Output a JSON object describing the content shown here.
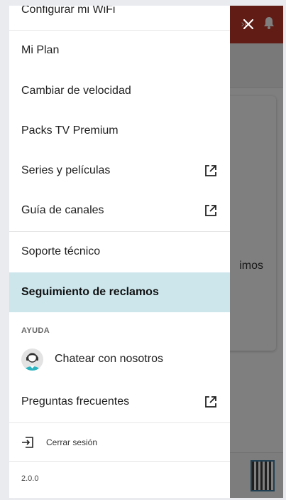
{
  "background": {
    "card_text": "imos"
  },
  "menu": {
    "items": [
      {
        "label": "Configurar mi WiFi",
        "external": false
      },
      {
        "label": "Mi Plan",
        "external": false
      },
      {
        "label": "Cambiar de velocidad",
        "external": false
      },
      {
        "label": "Packs TV Premium",
        "external": false
      },
      {
        "label": "Series y películas",
        "external": true
      },
      {
        "label": "Guía de canales",
        "external": true
      },
      {
        "label": "Soporte técnico",
        "external": false
      },
      {
        "label": "Seguimiento de reclamos",
        "external": false,
        "active": true
      }
    ],
    "help_section": "AYUDA",
    "chat_label": "Chatear con nosotros",
    "faq_label": "Preguntas frecuentes",
    "logout_label": "Cerrar sesión",
    "version": "2.0.0"
  },
  "colors": {
    "active_bg": "#cce6ec",
    "header_red": "#c0392b"
  },
  "icons": {
    "close": "close-icon",
    "external": "external-link-icon",
    "logout": "logout-icon",
    "bell": "bell-icon",
    "agent": "agent-avatar-icon"
  }
}
